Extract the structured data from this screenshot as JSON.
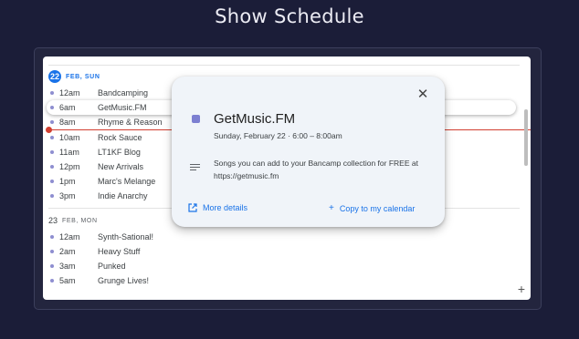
{
  "page": {
    "title": "Show Schedule"
  },
  "colors": {
    "accent": "#1a73e8",
    "event_dot": "#8e8ed0",
    "now_line": "#d23f31",
    "event_chip": "#7c7fd1"
  },
  "day1": {
    "date_num": "22",
    "label": "FEB, SUN",
    "events": [
      {
        "time": "12am",
        "name": "Bandcamping"
      },
      {
        "time": "6am",
        "name": "GetMusic.FM"
      },
      {
        "time": "8am",
        "name": "Rhyme & Reason"
      },
      {
        "time": "10am",
        "name": "Rock Sauce"
      },
      {
        "time": "11am",
        "name": "LT1KF Blog"
      },
      {
        "time": "12pm",
        "name": "New Arrivals"
      },
      {
        "time": "1pm",
        "name": "Marc's Melange"
      },
      {
        "time": "3pm",
        "name": "Indie Anarchy"
      }
    ]
  },
  "day2": {
    "date_num": "23",
    "label": "FEB, MON",
    "events": [
      {
        "time": "12am",
        "name": "Synth-Sational!"
      },
      {
        "time": "2am",
        "name": "Heavy Stuff"
      },
      {
        "time": "3am",
        "name": "Punked"
      },
      {
        "time": "5am",
        "name": "Grunge Lives!"
      }
    ]
  },
  "popup": {
    "title": "GetMusic.FM",
    "when": "Sunday, February 22  ·  6:00 – 8:00am",
    "description": "Songs you can add to your Bancamp collection for FREE at https://getmusic.fm",
    "more_details": "More details",
    "copy_to_calendar": "Copy to my calendar",
    "close_glyph": "✕"
  },
  "icons": {
    "close": "close-icon",
    "add": "plus-icon",
    "external": "open-in-new-icon",
    "description": "notes-icon"
  },
  "add_glyph": "+"
}
